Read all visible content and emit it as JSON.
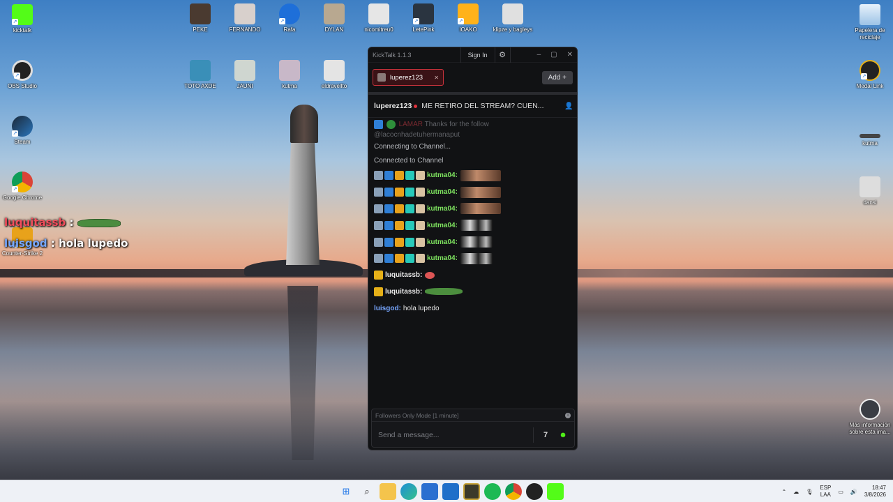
{
  "desktop": {
    "icons_left": [
      {
        "label": "kicktalk"
      },
      {
        "label": "OBS Studio"
      },
      {
        "label": "Steam"
      },
      {
        "label": "Google Chrome"
      },
      {
        "label": "Counter-Strike 2"
      }
    ],
    "icons_top_row1": [
      {
        "label": "PEKE"
      },
      {
        "label": "FERNANDO"
      },
      {
        "label": "Rafa"
      },
      {
        "label": "DYLAN"
      },
      {
        "label": "nicomitreu0"
      },
      {
        "label": "LetePink"
      },
      {
        "label": "IOAKO"
      },
      {
        "label": "klipze y bagleys"
      }
    ],
    "icons_top_row2": [
      {
        "label": "TOTO AXDE"
      },
      {
        "label": "JAUNI"
      },
      {
        "label": "kutma"
      },
      {
        "label": "eldravellto"
      }
    ],
    "icons_right": [
      {
        "label": "Papelera de reciclaje"
      },
      {
        "label": "Medal Link"
      },
      {
        "label": "kutma"
      },
      {
        "label": "dansi"
      },
      {
        "label": "Más información sobre esta ima..."
      }
    ],
    "overlay_chat": [
      {
        "user": "luquitassb",
        "sep": " :",
        "text": ""
      },
      {
        "user": "luisgod",
        "sep": " :",
        "text": " hola lupedo"
      }
    ]
  },
  "window": {
    "app_title": "KickTalk 1.1.3",
    "signin_label": "Sign In",
    "minimize": "–",
    "maximize": "▢",
    "close": "✕",
    "tabs": [
      {
        "label": "luperez123"
      }
    ],
    "add_label": "Add",
    "stream": {
      "name": "luperez123",
      "title": "ME RETIRO DEL STREAM? CUEN..."
    },
    "messages": {
      "faded_user": "LAMAR",
      "faded_text": "Thanks for the follow",
      "faded_text2": "@lacocnhadetuhermanaput",
      "system1": "Connecting to Channel...",
      "system2": "Connected to Channel",
      "kutma_user": "kutma04:",
      "luquitas_user": "luquitassb:",
      "luisgod_user": "luisgod:",
      "luisgod_text": "hola lupedo"
    },
    "followers_mode": "Followers Only Mode [1 minute]",
    "input_placeholder": "Send a message..."
  },
  "taskbar": {
    "lang1": "ESP",
    "lang2": "LAA",
    "time": "18:47",
    "date": "3/8/2026"
  },
  "colors": {
    "kick_green": "#53fc18",
    "tab_red": "#c8323c",
    "user_green": "#7ee35f",
    "user_blue": "#77a6ff"
  }
}
